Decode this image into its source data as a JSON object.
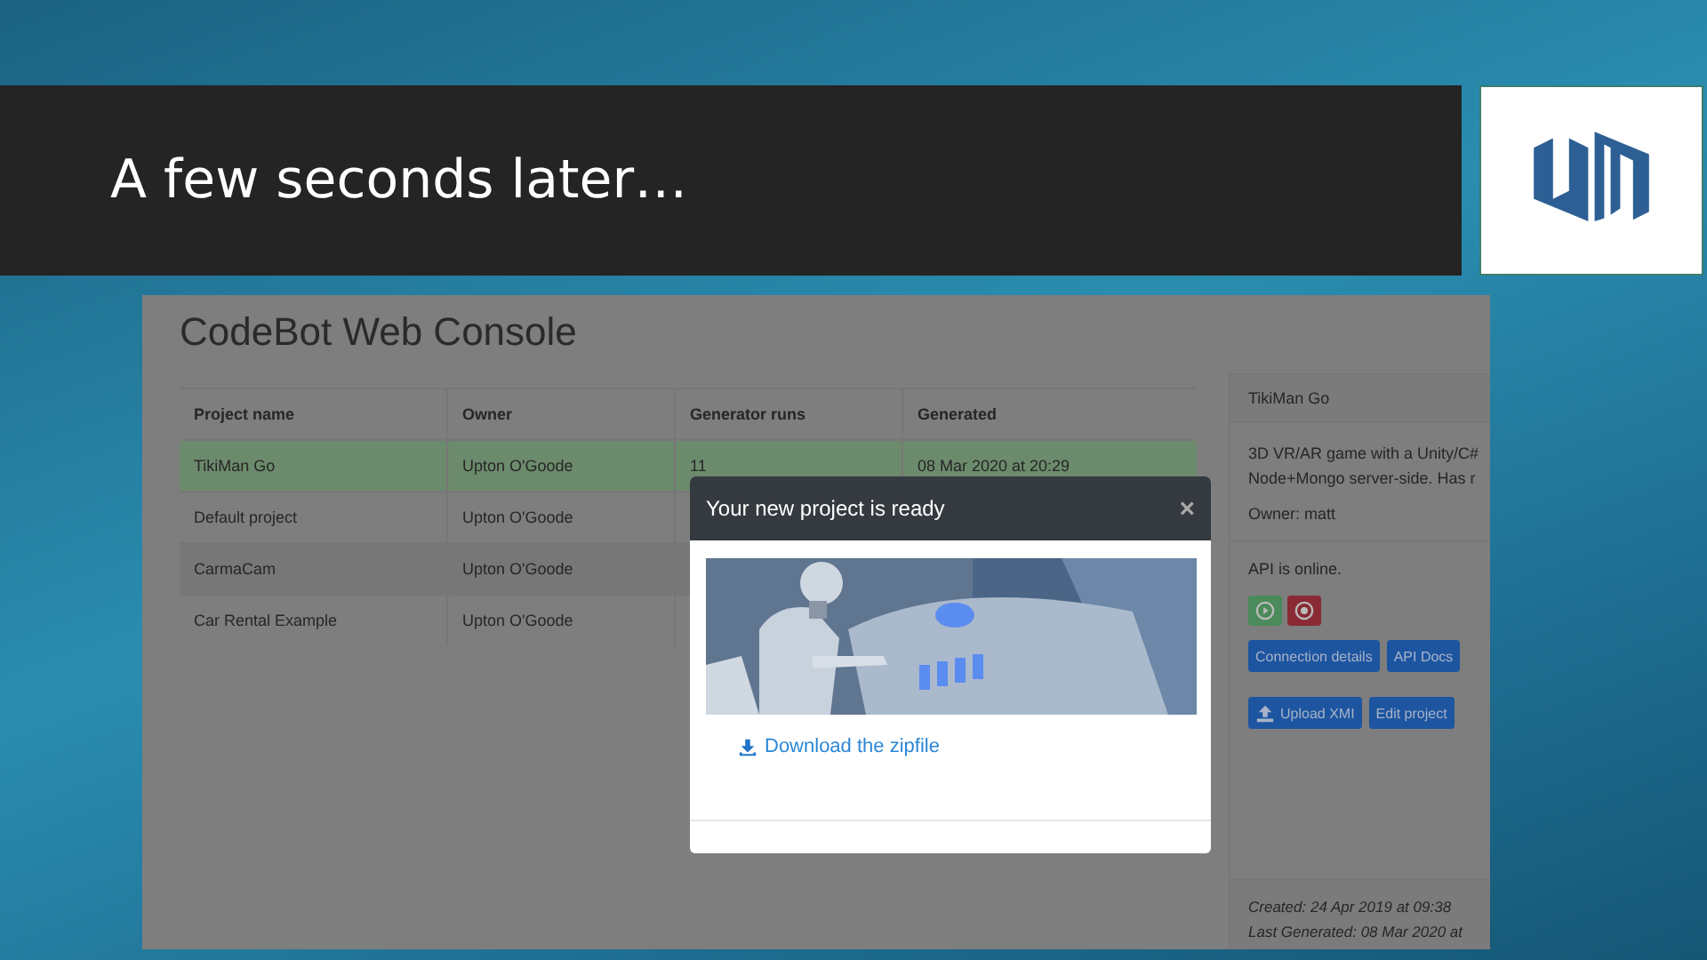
{
  "slide": {
    "title": "A few seconds later…"
  },
  "console": {
    "title": "CodeBot Web Console",
    "table": {
      "columns": [
        "Project name",
        "Owner",
        "Generator runs",
        "Generated"
      ],
      "rows": [
        {
          "cells": [
            "TikiMan Go",
            "Upton O'Goode",
            "11",
            "08 Mar 2020 at 20:29"
          ],
          "selected": true
        },
        {
          "cells": [
            "Default project",
            "Upton O'Goode"
          ],
          "selected": false
        },
        {
          "cells": [
            "CarmaCam",
            "Upton O'Goode"
          ],
          "selected": false
        },
        {
          "cells": [
            "Car Rental Example",
            "Upton O'Goode"
          ],
          "selected": false
        }
      ]
    },
    "details": {
      "title": "TikiMan Go",
      "description_lines": [
        "3D VR/AR game with a Unity/C#",
        "Node+Mongo server-side. Has r"
      ],
      "owner": "Owner: matt",
      "api_status": "API is online.",
      "controls": [
        {
          "kind": "play"
        },
        {
          "kind": "stop"
        }
      ],
      "button_rows": [
        [
          {
            "label": "Connection details"
          },
          {
            "label": "API Docs"
          }
        ],
        [
          {
            "label": "Upload XMI",
            "kind": "upload"
          },
          {
            "label": "Edit project"
          }
        ]
      ],
      "footer": [
        "Created: 24 Apr 2019 at 09:38",
        "Last Generated: 08 Mar 2020 at"
      ]
    }
  },
  "modal": {
    "title": "Your new project is ready",
    "close": "×",
    "link": "Download the zipfile"
  }
}
